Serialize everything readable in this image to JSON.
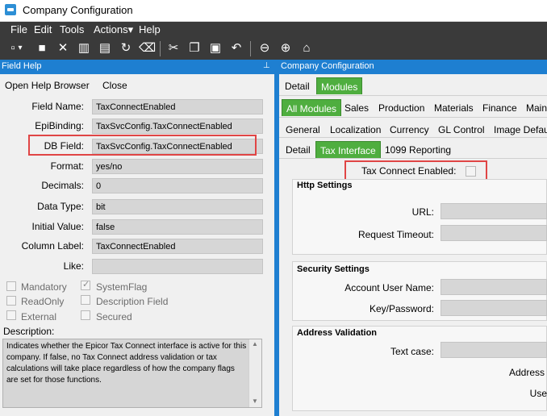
{
  "window": {
    "title": "Company Configuration"
  },
  "menu": [
    "File",
    "Edit",
    "Tools",
    "Actions▾",
    "Help"
  ],
  "toolbar_icons": [
    "new-icon",
    "save-icon",
    "delete-icon",
    "book-icon",
    "clipboard-icon",
    "refresh-icon",
    "clear-icon",
    "cut-icon",
    "copy-icon",
    "paste-icon",
    "undo-icon",
    "back-icon",
    "forward-icon",
    "home-icon"
  ],
  "field_help": {
    "title": "Field Help",
    "pin": "ᵍ",
    "open_browser": "Open Help Browser",
    "close": "Close",
    "fields": {
      "field_name_label": "Field Name:",
      "field_name": "TaxConnectEnabled",
      "epibinding_label": "EpiBinding:",
      "epibinding": "TaxSvcConfig.TaxConnectEnabled",
      "db_field_label": "DB Field:",
      "db_field": "TaxSvcConfig.TaxConnectEnabled",
      "format_label": "Format:",
      "format": "yes/no",
      "decimals_label": "Decimals:",
      "decimals": "0",
      "data_type_label": "Data Type:",
      "data_type": "bit",
      "initial_value_label": "Initial Value:",
      "initial_value": "false",
      "column_label_label": "Column Label:",
      "column_label": "TaxConnectEnabled",
      "like_label": "Like:",
      "like": ""
    },
    "checks": {
      "mandatory": "Mandatory",
      "system_flag": "SystemFlag",
      "read_only": "ReadOnly",
      "description_field": "Description Field",
      "external": "External",
      "secured": "Secured"
    },
    "description_label": "Description:",
    "description": "Indicates whether the Epicor Tax Connect interface is active for this company. If false, no Tax Connect address validation or tax calculations will take place regardless of how the company flags are set for those functions."
  },
  "config": {
    "title": "Company Configuration",
    "tabs1": [
      "Detail",
      "Modules"
    ],
    "tabs2": [
      "All Modules",
      "Sales",
      "Production",
      "Materials",
      "Finance",
      "Main"
    ],
    "tabs3": [
      "General",
      "Localization",
      "Currency",
      "GL Control",
      "Image Defaul"
    ],
    "tabs4": [
      "Detail",
      "Tax Interface",
      "1099 Reporting"
    ],
    "tax_connect_label": "Tax Connect Enabled:",
    "http_settings": "Http Settings",
    "url_label": "URL:",
    "request_timeout_label": "Request Timeout:",
    "security_settings": "Security Settings",
    "account_user_label": "Account User Name:",
    "key_password_label": "Key/Password:",
    "address_validation": "Address Validation",
    "text_case_label": "Text case:",
    "address_label": "Address",
    "use_label": "Use"
  }
}
